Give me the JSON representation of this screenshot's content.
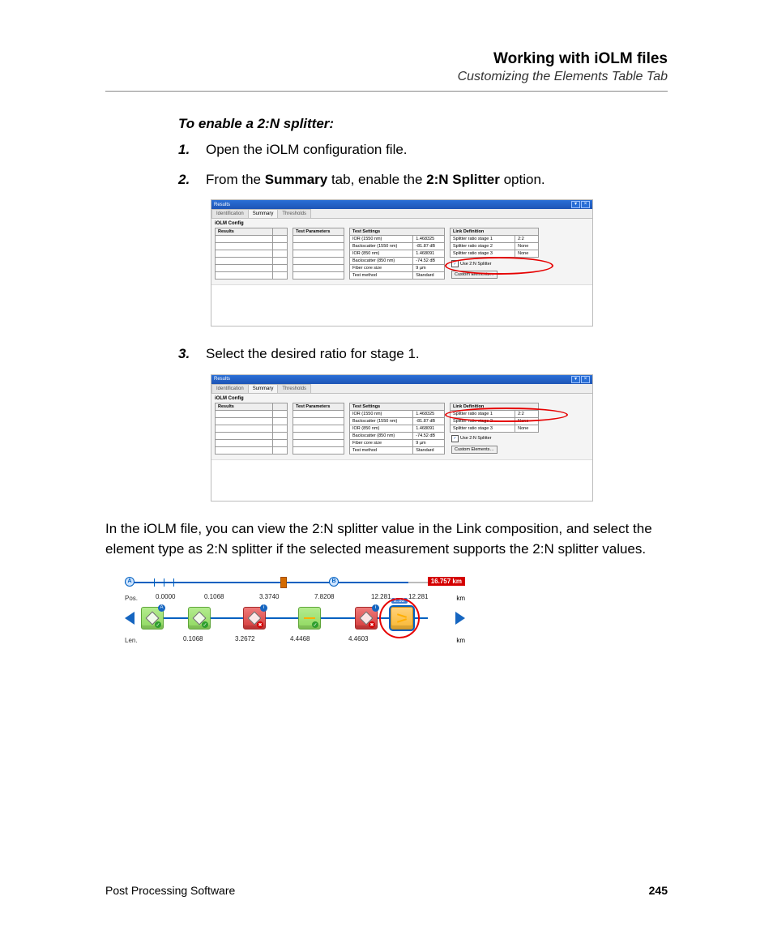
{
  "header": {
    "title": "Working with iOLM files",
    "subtitle": "Customizing the Elements Table Tab"
  },
  "proc_title": "To enable a 2:N splitter:",
  "steps": {
    "s1": {
      "num": "1.",
      "text": "Open the iOLM configuration file."
    },
    "s2": {
      "num": "2.",
      "pre": "From the ",
      "b1": "Summary",
      "mid": " tab, enable the ",
      "b2": "2:N Splitter",
      "post": " option."
    },
    "s3": {
      "num": "3.",
      "text": "Select the desired ratio for stage 1."
    }
  },
  "para": "In the iOLM file, you can view the 2:N splitter value in the Link composition, and select the element type as 2:N splitter if the selected measurement supports the 2:N splitter values.",
  "panel": {
    "title": "Results",
    "tabs": {
      "id": "Identification",
      "sum": "Summary",
      "thr": "Thresholds"
    },
    "section": "iOLM Config",
    "headers": {
      "results": "Results",
      "params": "Test Parameters",
      "settings": "Test Settings",
      "linkdef": "Link Definition"
    },
    "settings": [
      {
        "k": "IOR (1550 nm)",
        "v": "1.468325"
      },
      {
        "k": "Backscatter (1550 nm)",
        "v": "-81.87 dB"
      },
      {
        "k": "IOR (850 nm)",
        "v": "1.468091"
      },
      {
        "k": "Backscatter (850 nm)",
        "v": "-74.52 dB"
      },
      {
        "k": "Fiber core size",
        "v": "9 µm"
      },
      {
        "k": "Test method",
        "v": "Standard"
      }
    ],
    "linkdef": [
      {
        "k": "Splitter ratio stage 1",
        "v": "2:2"
      },
      {
        "k": "Splitter ratio stage 2",
        "v": "None"
      },
      {
        "k": "Splitter ratio stage 3",
        "v": "None"
      }
    ],
    "checkbox": "Use 2:N Splitter",
    "button": "Custom Elements…"
  },
  "linkfig": {
    "distance": "16.757 km",
    "markerA": "A",
    "markerB": "B",
    "posLabel": "Pos.",
    "lenLabel": "Len.",
    "unit": "km",
    "pos": [
      "0.0000",
      "0.1068",
      "3.3740",
      "7.8208",
      "12.281",
      "12.281"
    ],
    "len": [
      "0.1068",
      "3.2672",
      "4.4468",
      "4.4603"
    ],
    "tag": "2:32"
  },
  "footer": {
    "left": "Post Processing Software",
    "page": "245"
  }
}
